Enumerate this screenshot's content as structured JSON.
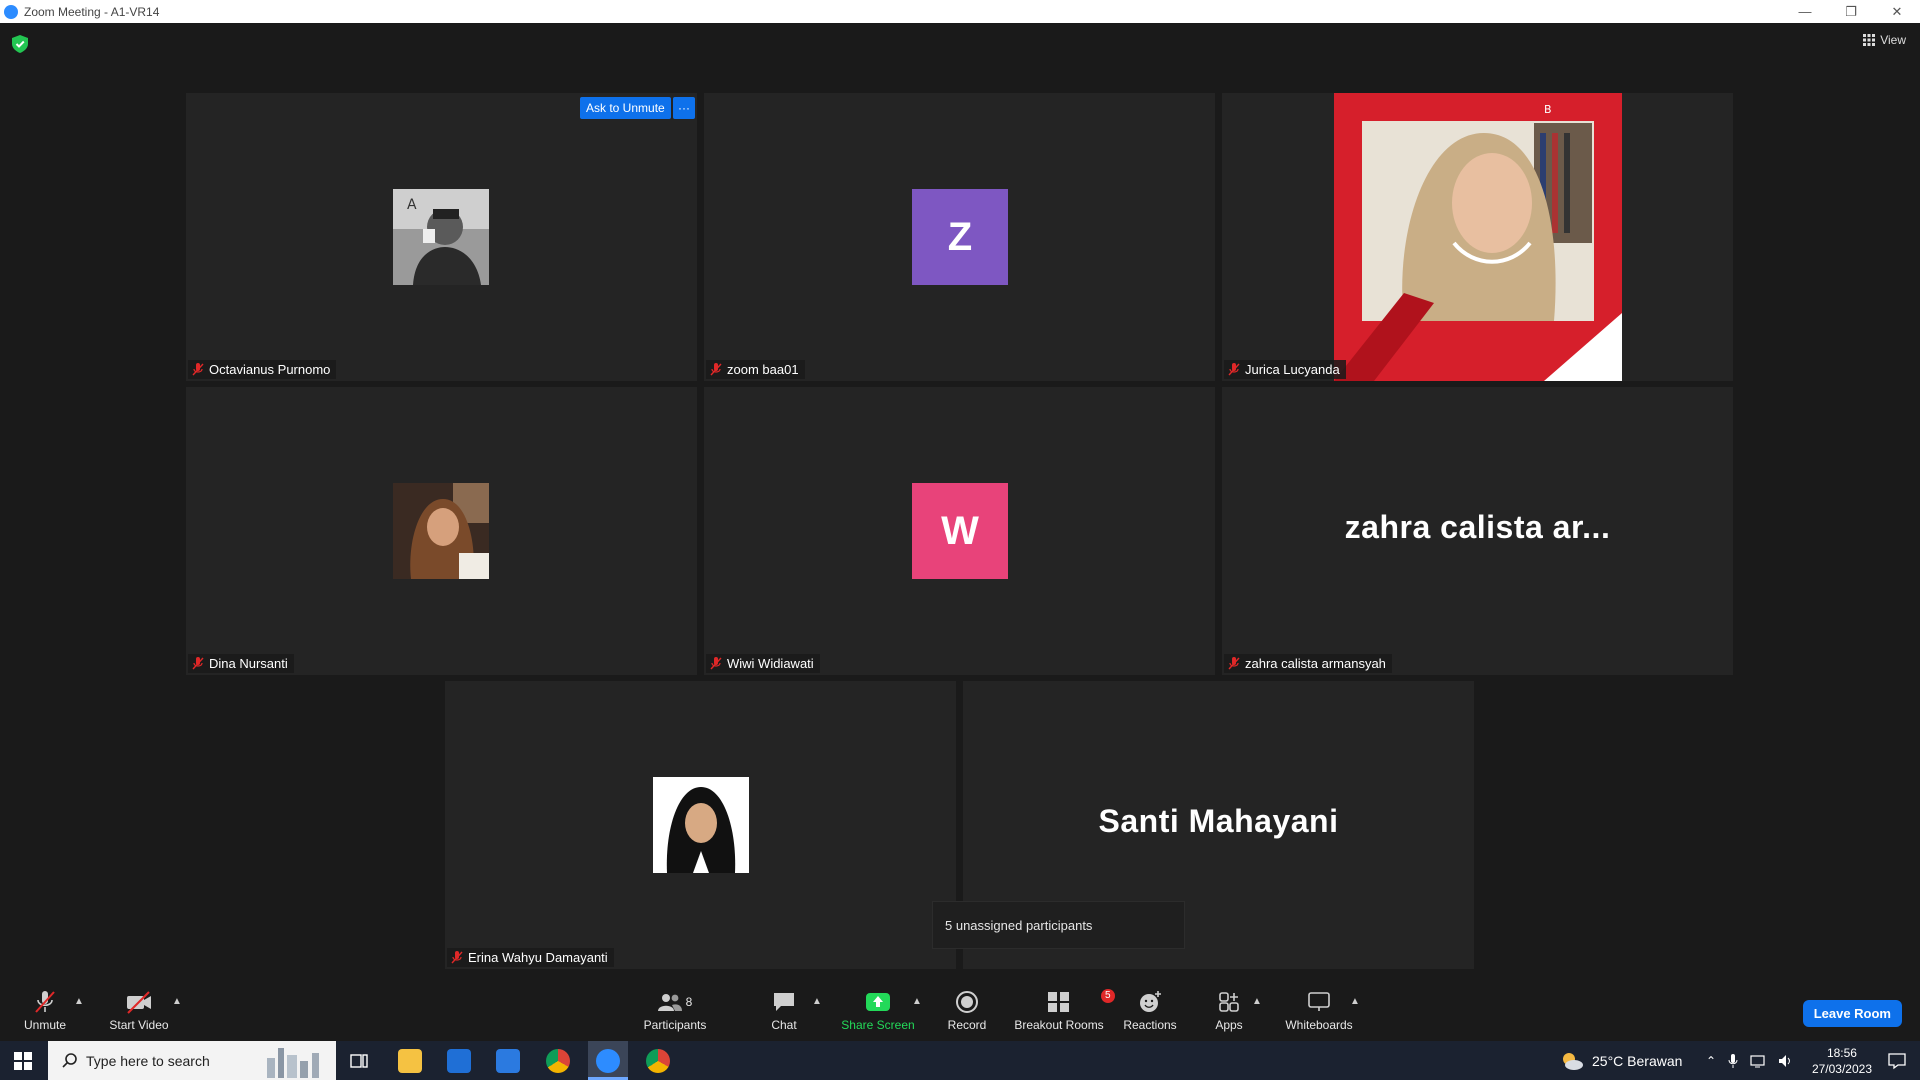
{
  "window": {
    "title": "Zoom Meeting - A1-VR14"
  },
  "header": {
    "view_label": "View"
  },
  "tiles": [
    {
      "name": "Octavianus Purnomo",
      "avatar": "photo-man"
    },
    {
      "name": "zoom baa01",
      "initial": "Z",
      "color": "#7e57c2"
    },
    {
      "name": "Jurica Lucyanda",
      "avatar": "video-woman"
    },
    {
      "name": "Dina Nursanti",
      "avatar": "photo-woman"
    },
    {
      "name": "Wiwi Widiawati",
      "initial": "W",
      "color": "#e8437a"
    },
    {
      "name": "zahra calista armansyah",
      "display": "zahra calista ar..."
    },
    {
      "name": "Erina Wahyu Damayanti",
      "avatar": "photo-woman-2"
    },
    {
      "display": "Santi Mahayani"
    }
  ],
  "active_tile": {
    "ask_unmute_label": "Ask to Unmute",
    "more_label": "···"
  },
  "tooltip": {
    "text": "5 unassigned participants"
  },
  "toolbar": {
    "unmute": "Unmute",
    "start_video": "Start Video",
    "participants": "Participants",
    "participants_count": "8",
    "chat": "Chat",
    "share_screen": "Share Screen",
    "record": "Record",
    "breakout_rooms": "Breakout Rooms",
    "breakout_badge": "5",
    "reactions": "Reactions",
    "apps": "Apps",
    "whiteboards": "Whiteboards",
    "leave_room": "Leave Room",
    "accent_color": "#0e71eb",
    "share_color": "#23d959"
  },
  "taskbar": {
    "search_placeholder": "Type here to search",
    "weather": "25°C  Berawan",
    "time": "18:56",
    "date": "27/03/2023"
  }
}
